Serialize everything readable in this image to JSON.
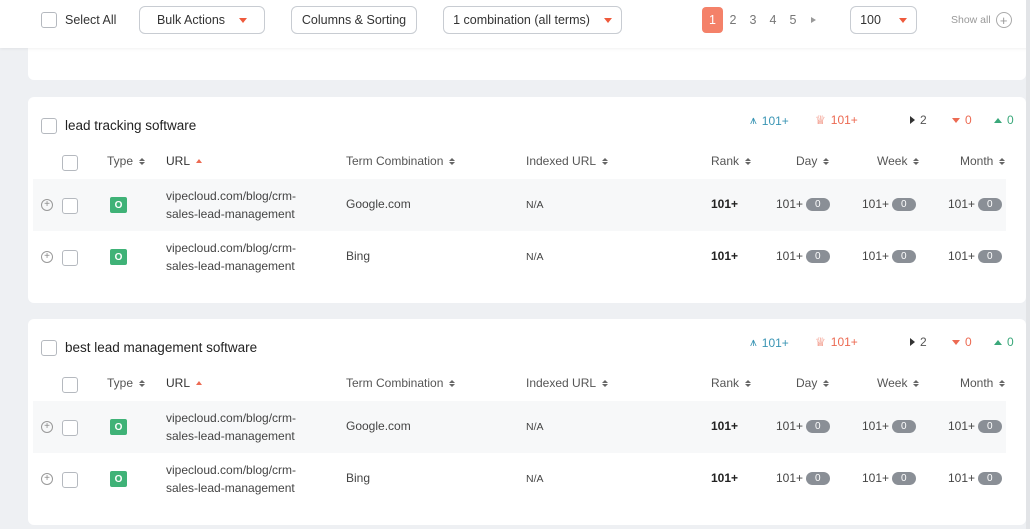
{
  "toolbar": {
    "select_all_label": "Select All",
    "bulk_actions_label": "Bulk Actions",
    "columns_sorting_label": "Columns & Sorting",
    "combination_label": "1 combination (all terms)",
    "pages": [
      "1",
      "2",
      "3",
      "4",
      "5"
    ],
    "active_page": "1",
    "per_page": "100",
    "show_all_label": "Show all"
  },
  "columns": {
    "type": "Type",
    "url": "URL",
    "term_combination": "Term Combination",
    "indexed_url": "Indexed URL",
    "rank": "Rank",
    "day": "Day",
    "week": "Week",
    "month": "Month"
  },
  "keywords": [
    {
      "title": "lead tracking software",
      "stats": {
        "visibility": "101+",
        "best": "101+",
        "neutral": "2",
        "down": "0",
        "up": "0"
      },
      "rows": [
        {
          "type": "O",
          "url_line1": "vipecloud.com/blog/crm-",
          "url_line2": "sales-lead-management",
          "term": "Google.com",
          "indexed": "N/A",
          "rank": "101+",
          "day": "101+",
          "day_chg": "0",
          "week": "101+",
          "week_chg": "0",
          "month": "101+",
          "month_chg": "0"
        },
        {
          "type": "O",
          "url_line1": "vipecloud.com/blog/crm-",
          "url_line2": "sales-lead-management",
          "term": "Bing",
          "indexed": "N/A",
          "rank": "101+",
          "day": "101+",
          "day_chg": "0",
          "week": "101+",
          "week_chg": "0",
          "month": "101+",
          "month_chg": "0"
        }
      ]
    },
    {
      "title": "best lead management software",
      "stats": {
        "visibility": "101+",
        "best": "101+",
        "neutral": "2",
        "down": "0",
        "up": "0"
      },
      "rows": [
        {
          "type": "O",
          "url_line1": "vipecloud.com/blog/crm-",
          "url_line2": "sales-lead-management",
          "term": "Google.com",
          "indexed": "N/A",
          "rank": "101+",
          "day": "101+",
          "day_chg": "0",
          "week": "101+",
          "week_chg": "0",
          "month": "101+",
          "month_chg": "0"
        },
        {
          "type": "O",
          "url_line1": "vipecloud.com/blog/crm-",
          "url_line2": "sales-lead-management",
          "term": "Bing",
          "indexed": "N/A",
          "rank": "101+",
          "day": "101+",
          "day_chg": "0",
          "week": "101+",
          "week_chg": "0",
          "month": "101+",
          "month_chg": "0"
        }
      ]
    }
  ],
  "colors": {
    "accent": "#f48169",
    "type_badge": "#3fb277",
    "teal": "#3a95b4",
    "coral": "#ec6a52",
    "green": "#3aa87a"
  }
}
